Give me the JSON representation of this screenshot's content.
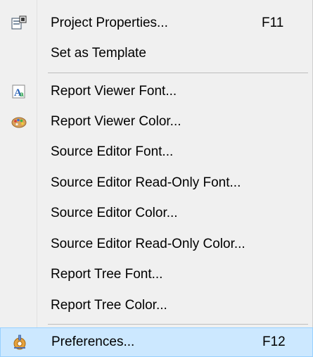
{
  "menu": {
    "items": [
      {
        "label": "Project Properties...",
        "shortcut": "F11",
        "icon": "project-properties-icon"
      },
      {
        "label": "Set as Template"
      },
      {
        "label": "Report Viewer Font...",
        "icon": "font-icon"
      },
      {
        "label": "Report Viewer Color...",
        "icon": "palette-icon"
      },
      {
        "label": "Source Editor Font..."
      },
      {
        "label": "Source Editor Read-Only Font..."
      },
      {
        "label": "Source Editor Color..."
      },
      {
        "label": "Source Editor Read-Only Color..."
      },
      {
        "label": "Report Tree Font..."
      },
      {
        "label": "Report Tree Color..."
      },
      {
        "label": "Preferences...",
        "shortcut": "F12",
        "icon": "preferences-icon",
        "highlighted": true
      }
    ]
  },
  "colors": {
    "menu_background": "#f0f0f0",
    "highlight_background": "#cce8ff",
    "highlight_border": "#99d1ff"
  }
}
